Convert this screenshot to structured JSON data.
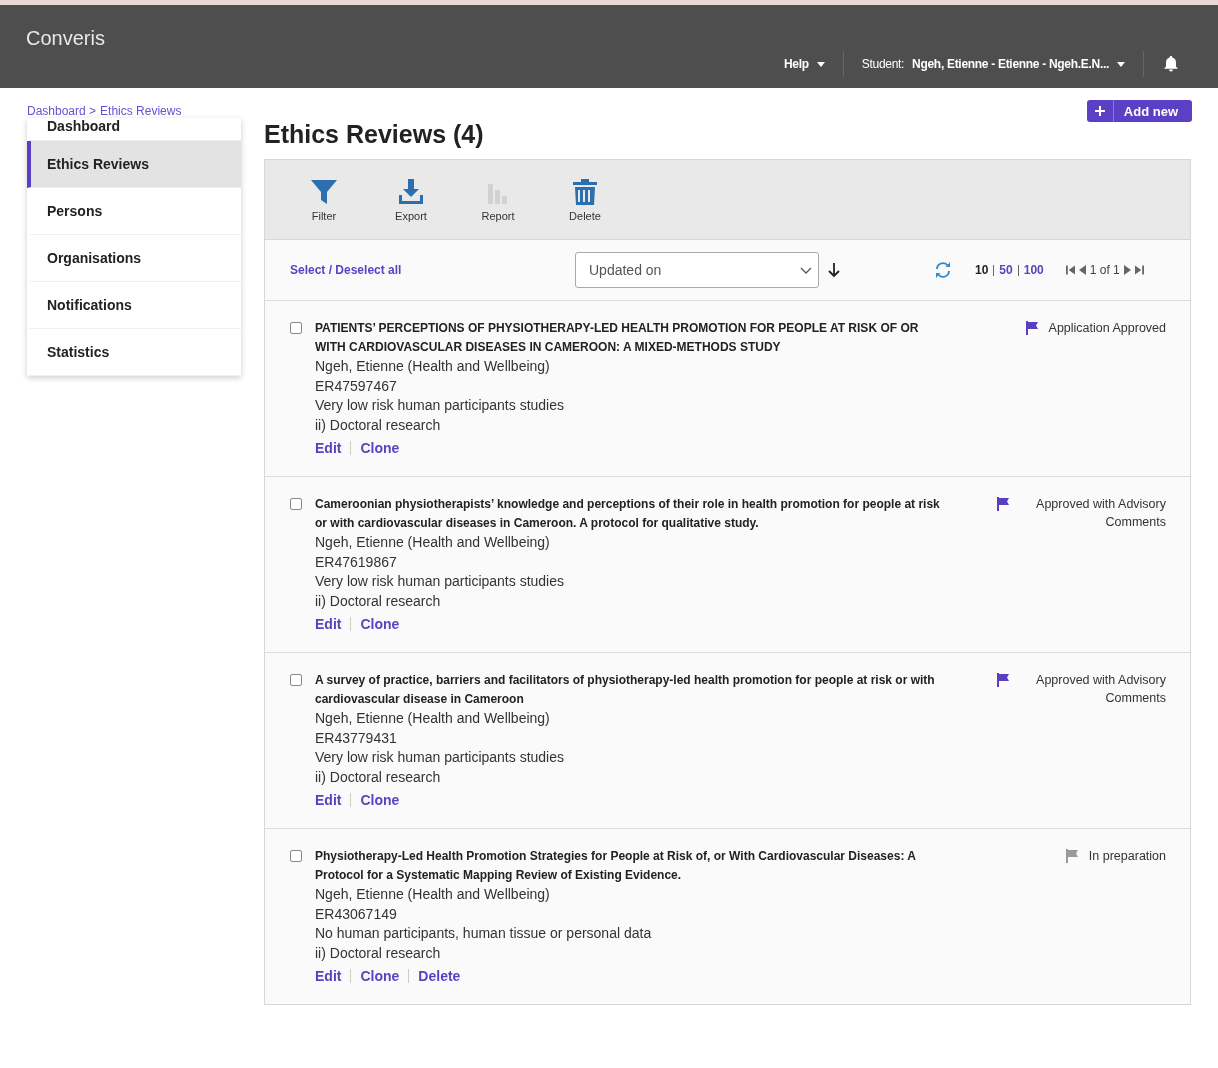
{
  "header": {
    "brand": "Converis",
    "help": "Help",
    "user_prefix": "Student:",
    "user_name": "Ngeh, Etienne - Etienne - Ngeh.E.N..."
  },
  "breadcrumb": [
    "Dashboard >",
    "Ethics Reviews"
  ],
  "sidebar": {
    "items": [
      {
        "label": "Dashboard",
        "selected": false
      },
      {
        "label": "Ethics Reviews",
        "selected": true
      },
      {
        "label": "Persons",
        "selected": false
      },
      {
        "label": "Organisations",
        "selected": false
      },
      {
        "label": "Notifications",
        "selected": false
      },
      {
        "label": "Statistics",
        "selected": false
      }
    ]
  },
  "add_button": "Add new",
  "page_title": "Ethics Reviews (4)",
  "toolbar": [
    {
      "kind": "filter",
      "label": "Filter",
      "disabled": false
    },
    {
      "kind": "export",
      "label": "Export",
      "disabled": false
    },
    {
      "kind": "report",
      "label": "Report",
      "disabled": true
    },
    {
      "kind": "delete",
      "label": "Delete",
      "disabled": false
    }
  ],
  "list_controls": {
    "select_all": "Select / Deselect all",
    "sort": "Updated on",
    "page_sizes": [
      {
        "label": "10",
        "selected": true
      },
      {
        "label": "50",
        "selected": false
      },
      {
        "label": "100",
        "selected": false
      }
    ],
    "pager": "1 of 1"
  },
  "records": [
    {
      "title": "PATIENTS’ PERCEPTIONS OF PHYSIOTHERAPY-LED HEALTH PROMOTION FOR PEOPLE AT RISK OF OR WITH CARDIOVASCULAR DISEASES IN CAMEROON: A MIXED-METHODS STUDY",
      "checked": false,
      "lines": [
        "Ngeh, Etienne (Health and Wellbeing)",
        "ER47597467",
        "Very low risk human participants studies",
        "ii) Doctoral research"
      ],
      "actions": [
        "Edit",
        "Clone"
      ],
      "status": "Application Approved",
      "color": "#5a3fc0"
    },
    {
      "title": "Cameroonian physiotherapists’ knowledge and perceptions of their role in health promotion for people at risk or with cardiovascular diseases in Cameroon. A protocol for qualitative study.",
      "checked": false,
      "lines": [
        "Ngeh, Etienne (Health and Wellbeing)",
        "ER47619867",
        "Very low risk human participants studies",
        "ii) Doctoral research"
      ],
      "actions": [
        "Edit",
        "Clone"
      ],
      "status": "Approved with Advisory Comments",
      "color": "#5a3fc0"
    },
    {
      "title": "A survey of practice, barriers and facilitators of physiotherapy-led health promotion for people at risk or with cardiovascular disease in Cameroon",
      "checked": false,
      "lines": [
        "Ngeh, Etienne (Health and Wellbeing)",
        "ER43779431",
        "Very low risk human participants studies",
        "ii) Doctoral research"
      ],
      "actions": [
        "Edit",
        "Clone"
      ],
      "status": "Approved with Advisory Comments",
      "color": "#5a3fc0"
    },
    {
      "title": "Physiotherapy-Led Health Promotion Strategies for People at Risk of, or With Cardiovascular Diseases: A Protocol for a Systematic Mapping Review of Existing Evidence.",
      "checked": false,
      "lines": [
        "Ngeh, Etienne (Health and Wellbeing)",
        "ER43067149",
        "No human participants, human tissue or personal data",
        "ii) Doctoral research"
      ],
      "actions": [
        "Edit",
        "Clone",
        "Delete"
      ],
      "status": "In preparation",
      "color": "#9a9a9a"
    }
  ]
}
